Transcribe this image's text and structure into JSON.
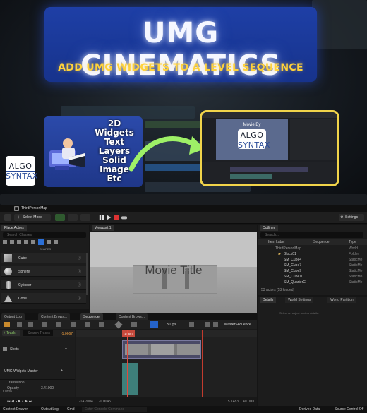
{
  "banner": {
    "title": "UMG CINEMATICS",
    "subtitle": "ADD UMG WIDGETS TO A LEVEL SEQUENCE",
    "logo_line1": "ALGO",
    "logo_line2": "SYNTAX",
    "features": [
      "2D",
      "Widgets",
      "Text",
      "Layers",
      "Solid",
      "Image",
      "Etc"
    ],
    "preview_title": "Movie By",
    "preview_logo_line1": "ALGO",
    "preview_logo_line2": "SYNTAX"
  },
  "editor": {
    "map_tab": "ThirdPersonMap",
    "toolbar": {
      "select_mode": "Select Mode",
      "settings": "Settings"
    },
    "place_actors": {
      "tab": "Place Actors",
      "search_placeholder": "Search Classes",
      "section": "SHAPES",
      "items": [
        "Cube",
        "Sphere",
        "Cylinder",
        "Cone"
      ]
    },
    "viewport": {
      "tab": "Viewport 1",
      "movie_title": "Movie Title"
    },
    "outliner": {
      "tab": "Outliner",
      "search_placeholder": "Search...",
      "columns": [
        "Item Label",
        "Sequence",
        "Type"
      ],
      "rows": [
        {
          "label": "ThirdPersonMap",
          "type": "World"
        },
        {
          "label": "Block01",
          "type": "Folder"
        },
        {
          "label": "SM_Cube4",
          "type": "StaticMe"
        },
        {
          "label": "SM_Cube7",
          "type": "StaticMe"
        },
        {
          "label": "SM_Cube9",
          "type": "StaticMe"
        },
        {
          "label": "SM_Cube10",
          "type": "StaticMe"
        },
        {
          "label": "SM_QuarterC",
          "type": "StaticMe"
        }
      ],
      "status": "53 actors (53 loaded)"
    },
    "details": {
      "tabs": [
        "Details",
        "World Settings",
        "World Partition"
      ],
      "empty": "Select an object to view details."
    },
    "bottom_tabs": [
      "Output Log",
      "Content Brows...",
      "Sequencer",
      "Content Brows..."
    ],
    "sequencer": {
      "fps": "30 fps",
      "breadcrumb": "MasterSequence",
      "add_track": "+ Track",
      "search_placeholder": "Search Tracks",
      "current_frame": "-1.0667",
      "playhead_label": "-1.0667",
      "tracks": [
        {
          "name": "Shots"
        },
        {
          "name": "UMG Widgets Master"
        },
        {
          "name": "Translation"
        },
        {
          "name": "Opacity",
          "value": "3.41000"
        }
      ],
      "item_count": "6 items",
      "range_start": "-14.7004",
      "range_start2": "-0.0045",
      "range_end": "15.1483",
      "range_end2": "40.0000"
    },
    "status_bar": {
      "content_drawer": "Content Drawer",
      "output_log": "Output Log",
      "cmd": "Cmd",
      "console_placeholder": "Enter Console Command",
      "derived_data": "Derived Data",
      "source_control": "Source Control Off"
    }
  }
}
